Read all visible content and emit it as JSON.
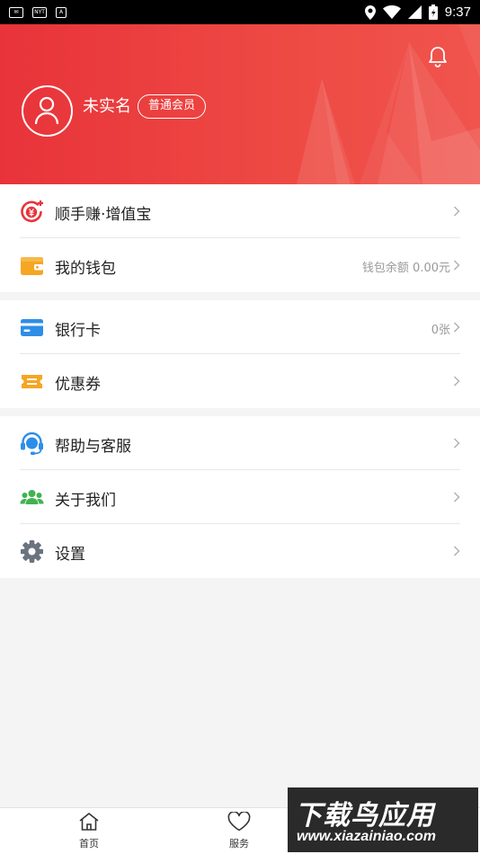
{
  "status_bar": {
    "time": "9:37",
    "icons": [
      "gmail-icon",
      "nyt-icon",
      "a-icon",
      "location-icon",
      "wifi-icon",
      "signal-icon",
      "battery-icon"
    ]
  },
  "header": {
    "user_name": "未实名",
    "member_badge": "普通会员",
    "bell_icon": "bell-icon",
    "avatar_icon": "user-icon"
  },
  "menu_groups": [
    [
      {
        "id": "shunshouzhuan",
        "label": "顺手赚·增值宝",
        "value": "",
        "icon": "yuan-coin-icon",
        "color": "#e8333a"
      },
      {
        "id": "wallet",
        "label": "我的钱包",
        "value": "钱包余额 0.00元",
        "icon": "wallet-icon",
        "color": "#f5a623"
      }
    ],
    [
      {
        "id": "bank-card",
        "label": "银行卡",
        "value": "0张",
        "icon": "bank-card-icon",
        "color": "#2d8ee8"
      },
      {
        "id": "coupon",
        "label": "优惠券",
        "value": "",
        "icon": "coupon-icon",
        "color": "#f5a623"
      }
    ],
    [
      {
        "id": "help",
        "label": "帮助与客服",
        "value": "",
        "icon": "headset-icon",
        "color": "#2d8ee8"
      },
      {
        "id": "about",
        "label": "关于我们",
        "value": "",
        "icon": "people-icon",
        "color": "#3fb34f"
      },
      {
        "id": "settings",
        "label": "设置",
        "value": "",
        "icon": "gear-icon",
        "color": "#6b7380"
      }
    ]
  ],
  "tab_bar": [
    {
      "label": "首页",
      "icon": "home-icon"
    },
    {
      "label": "服务",
      "icon": "heart-icon"
    }
  ],
  "watermark": {
    "title": "下载鸟应用",
    "url": "www.xiazainiao.com"
  }
}
